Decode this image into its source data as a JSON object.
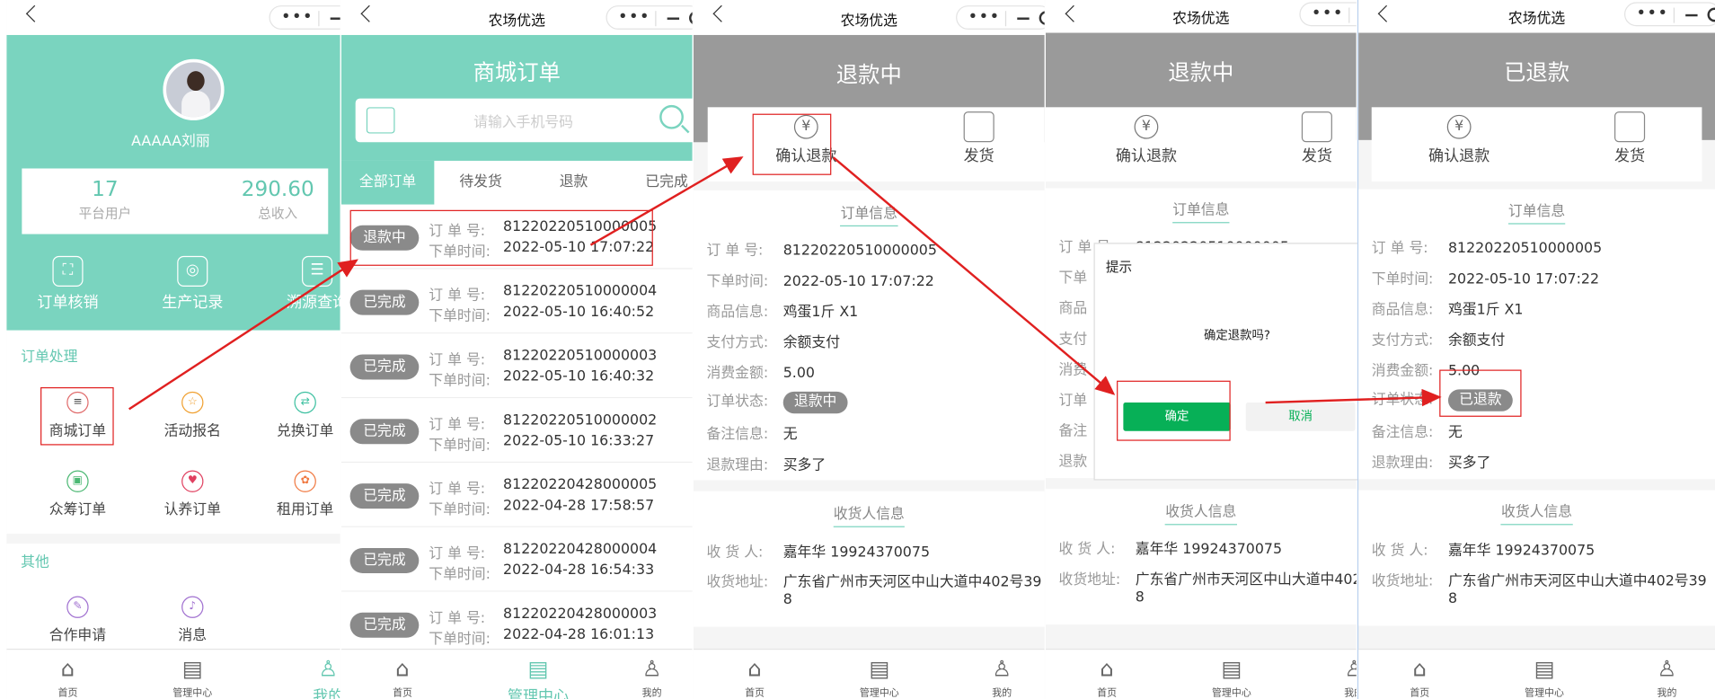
{
  "common": {
    "app_title": "农场优选",
    "tabs": {
      "home": "首页",
      "mgmt": "管理中心",
      "mine": "我的"
    }
  },
  "s1": {
    "username": "AAAAA刘丽",
    "stats": [
      {
        "value": "17",
        "label": "平台用户"
      },
      {
        "value": "290.60",
        "label": "总收入"
      }
    ],
    "quick": [
      {
        "label": "订单核销"
      },
      {
        "label": "生产记录"
      },
      {
        "label": "溯源查询"
      }
    ],
    "section1": "订单处理",
    "grid1": [
      {
        "label": "商城订单"
      },
      {
        "label": "活动报名"
      },
      {
        "label": "兑换订单"
      },
      {
        "label": "众筹订单"
      },
      {
        "label": "认养订单"
      },
      {
        "label": "租用订单"
      }
    ],
    "section2": "其他",
    "grid2": [
      {
        "label": "合作申请"
      },
      {
        "label": "消息"
      }
    ]
  },
  "s2": {
    "title": "商城订单",
    "search_placeholder": "请输入手机号码",
    "tabs": [
      "全部订单",
      "待发货",
      "退款",
      "已完成"
    ],
    "order_no_label": "订 单 号:",
    "time_label": "下单时间:",
    "orders": [
      {
        "status": "退款中",
        "no": "81220220510000005",
        "time": "2022-05-10 17:07:22"
      },
      {
        "status": "已完成",
        "no": "81220220510000004",
        "time": "2022-05-10 16:40:52"
      },
      {
        "status": "已完成",
        "no": "81220220510000003",
        "time": "2022-05-10 16:40:32"
      },
      {
        "status": "已完成",
        "no": "81220220510000002",
        "time": "2022-05-10 16:33:27"
      },
      {
        "status": "已完成",
        "no": "81220220428000005",
        "time": "2022-04-28 17:58:57"
      },
      {
        "status": "已完成",
        "no": "81220220428000004",
        "time": "2022-04-28 16:54:33"
      },
      {
        "status": "已完成",
        "no": "81220220428000003",
        "time": "2022-04-28 16:01:13"
      }
    ]
  },
  "detail": {
    "confirm_refund": "确认退款",
    "ship": "发货",
    "yen": "¥",
    "order_info": "订单信息",
    "receiver_info": "收货人信息",
    "labels": {
      "no": "订 单 号:",
      "time": "下单时间:",
      "goods": "商品信息:",
      "pay": "支付方式:",
      "amount": "消费金额:",
      "status": "订单状态:",
      "remark": "备注信息:",
      "reason": "退款理由:",
      "receiver": "收 货 人:",
      "address": "收货地址:"
    },
    "values": {
      "no": "81220220510000005",
      "time": "2022-05-10 17:07:22",
      "goods": "鸡蛋1斤 X1",
      "pay": "余额支付",
      "amount": "5.00",
      "remark": "无",
      "reason": "买多了",
      "receiver": "嘉年华 19924370075",
      "address1": "广东省广州市天河区中山大道中402号39",
      "address2": "8"
    }
  },
  "s3": {
    "title": "退款中",
    "status": "退款中"
  },
  "s4": {
    "title": "退款中",
    "modal_title": "提示",
    "modal_msg": "确定退款吗?",
    "ok": "确定",
    "cancel": "取消",
    "partial": {
      "no_label": "订 单 号:",
      "no": "81220220510000005",
      "time_label": "下单",
      "goods_label": "商品",
      "pay_label": "支付",
      "amount_label": "消费",
      "status_label": "订单",
      "remark_label": "备注",
      "reason_label": "退款"
    }
  },
  "s5": {
    "title": "已退款",
    "status": "已退款"
  },
  "colors": {
    "teal": "#7ad4bf",
    "grey": "#9a9a9a",
    "green": "#07b057",
    "red": "#e02020"
  }
}
